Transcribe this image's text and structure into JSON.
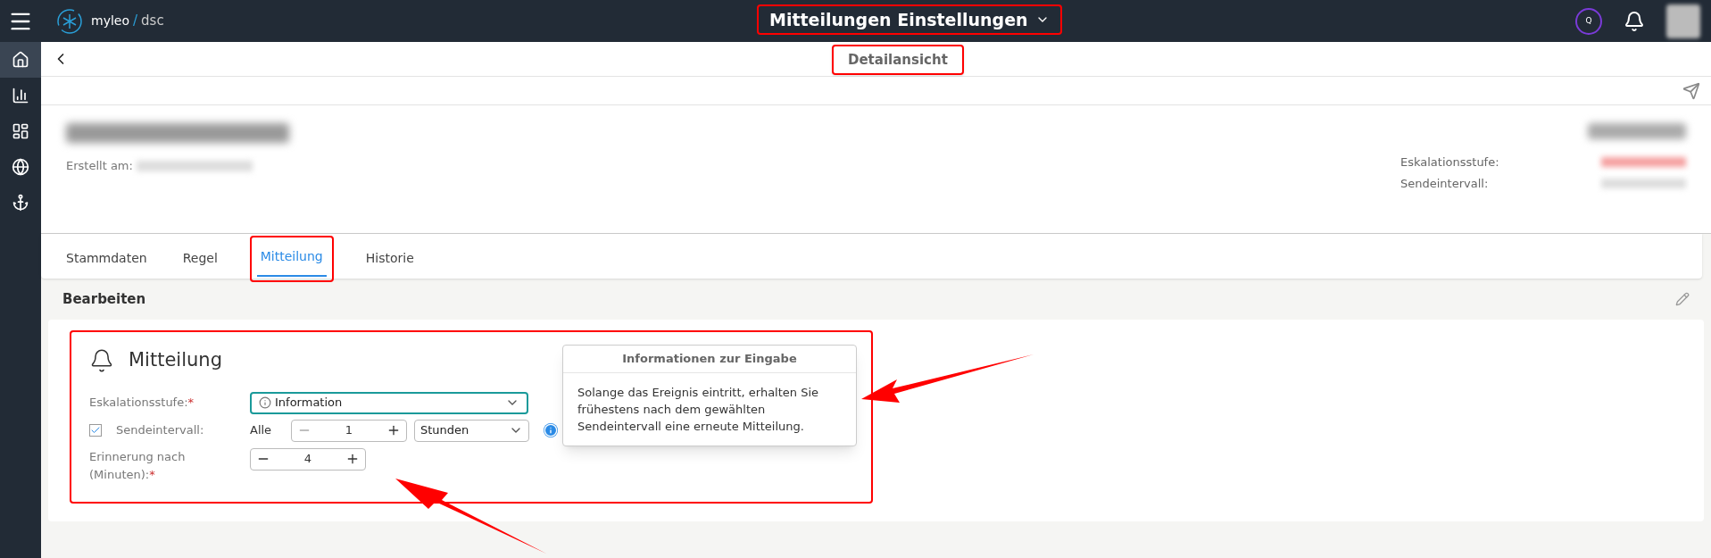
{
  "topbar": {
    "brand": "myleo",
    "brand_separator": "/",
    "brand_suffix": "dsc",
    "q_label": "Q",
    "title": "Mitteilungen Einstellungen"
  },
  "sidebar": {
    "items": [
      {
        "kind": "home",
        "selected": true
      },
      {
        "kind": "chart",
        "selected": false
      },
      {
        "kind": "dashboard",
        "selected": false
      },
      {
        "kind": "globe",
        "selected": false
      },
      {
        "kind": "anchor",
        "selected": false
      }
    ]
  },
  "subheader": {
    "title": "Detailansicht"
  },
  "header": {
    "created_label": "Erstellt am:",
    "details": [
      {
        "label": "Eskalationsstufe:"
      },
      {
        "label": "Sendeintervall:"
      }
    ]
  },
  "tabs": [
    {
      "label": "Stammdaten",
      "selected": false
    },
    {
      "label": "Regel",
      "selected": false
    },
    {
      "label": "Mitteilung",
      "selected": true
    },
    {
      "label": "Historie",
      "selected": false
    }
  ],
  "section": {
    "title": "Bearbeiten"
  },
  "card": {
    "title": "Mitteilung",
    "escalation": {
      "label": "Eskalationsstufe:",
      "required": "*",
      "value": "Information"
    },
    "interval": {
      "checked": true,
      "label": "Sendeintervall:",
      "prefix": "Alle",
      "value": "1",
      "unit": "Stunden"
    },
    "reminder": {
      "label_line1": "Erinnerung nach",
      "label_line2": "(Minuten):",
      "required": "*",
      "value": "4"
    }
  },
  "tooltip": {
    "title": "Informationen zur Eingabe",
    "text": "Solange das Ereignis eintritt, erhalten Sie frühestens nach dem gewählten Sendeintervall eine erneute Mitteilung."
  }
}
